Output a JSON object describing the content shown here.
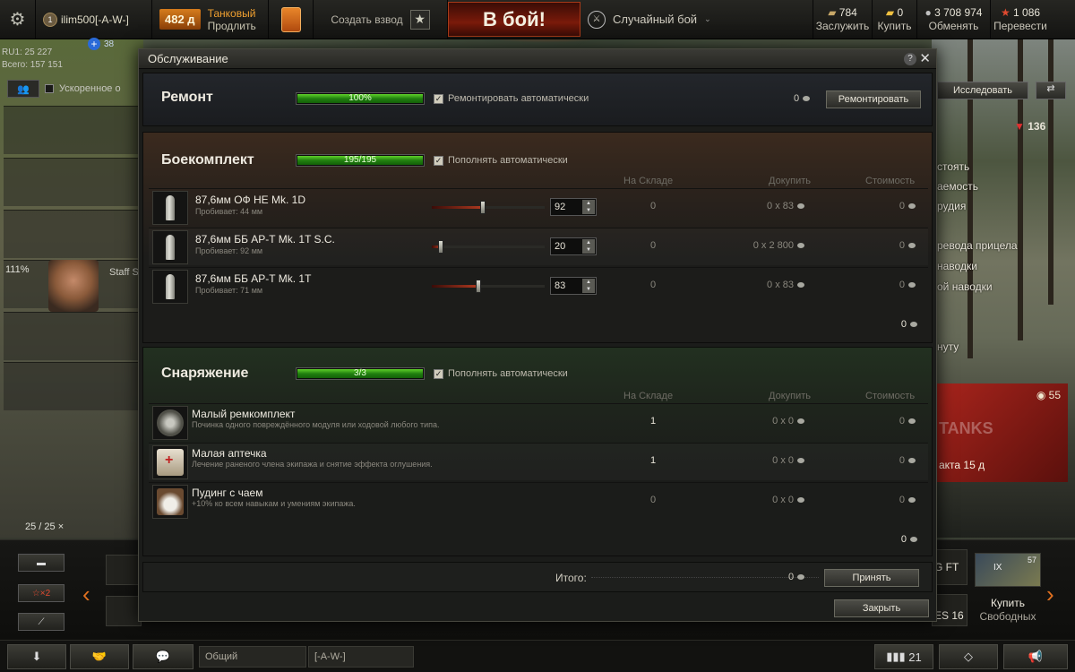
{
  "topbar": {
    "player_name": "ilim500[-A-W-]",
    "rank_badge": "1",
    "premium_days": "482 д",
    "premium_label": "Танковый",
    "premium_action": "Продлить",
    "platoon_label": "Создать взвод",
    "battle_button": "В бой!",
    "battle_mode": "Случайный бой",
    "resources": [
      {
        "value": "784",
        "label": "Заслужить",
        "icon": "xp-icon"
      },
      {
        "value": "0",
        "label": "Купить",
        "icon": "gold-icon"
      },
      {
        "value": "3 708 974",
        "label": "Обменять",
        "icon": "credits-icon"
      },
      {
        "value": "1 086",
        "label": "Перевести",
        "icon": "free-xp-icon"
      }
    ]
  },
  "left_info": {
    "line1": "RU1: 25 227",
    "line2": "Всего: 157 151",
    "notify_count": "38",
    "crew_label": "Ускоренное о",
    "crew_pct": "111%",
    "crew_role": "Staff S",
    "tank_count": "25 / 25"
  },
  "right_info": {
    "research": "Исследовать",
    "stat": "136",
    "lines": [
      "стоять",
      "аемость",
      "рудия",
      "ревода прицела",
      "наводки",
      "ой наводки",
      "нуту"
    ],
    "promo_count": "55",
    "promo_text": "акта 15 д",
    "promo_logo": "TANKS"
  },
  "dialog": {
    "title": "Обслуживание",
    "repair": {
      "title": "Ремонт",
      "progress_text": "100%",
      "progress": 1.0,
      "auto_label": "Ремонтировать автоматически",
      "auto_checked": true,
      "cost": "0",
      "button": "Ремонтировать"
    },
    "ammo": {
      "title": "Боекомплект",
      "progress_text": "195/195",
      "progress": 1.0,
      "auto_label": "Пополнять автоматически",
      "columns": [
        "На Складе",
        "Докупить",
        "Стоимость"
      ],
      "items": [
        {
          "name": "87,6мм ОФ HE Mk. 1D",
          "desc": "Пробивает: 44 мм",
          "count": "92",
          "level": 0.45,
          "stock": "0",
          "buy": "0 x 83",
          "cost": "0"
        },
        {
          "name": "87,6мм ББ AP-T Mk. 1T S.C.",
          "desc": "Пробивает: 92 мм",
          "count": "20",
          "level": 0.08,
          "stock": "0",
          "buy": "0 x 2 800",
          "cost": "0"
        },
        {
          "name": "87,6мм ББ AP-T Mk. 1T",
          "desc": "Пробивает: 71 мм",
          "count": "83",
          "level": 0.41,
          "stock": "0",
          "buy": "0 x 83",
          "cost": "0"
        }
      ],
      "subtotal": "0"
    },
    "equipment": {
      "title": "Снаряжение",
      "progress_text": "3/3",
      "progress": 1.0,
      "auto_label": "Пополнять автоматически",
      "columns": [
        "На Складе",
        "Докупить",
        "Стоимость"
      ],
      "items": [
        {
          "name": "Малый ремкомплект",
          "desc": "Починка одного повреждённого модуля или ходовой любого типа.",
          "stock": "1",
          "buy": "0 x 0",
          "cost": "0",
          "icon": "repair-kit-icon"
        },
        {
          "name": "Малая аптечка",
          "desc": "Лечение раненого члена экипажа и снятие эффекта оглушения.",
          "stock": "1",
          "buy": "0 x 0",
          "cost": "0",
          "icon": "first-aid-icon"
        },
        {
          "name": "Пудинг с чаем",
          "desc": "+10% ко всем навыкам и умениям экипажа.",
          "stock": "0",
          "buy": "0 x 0",
          "cost": "0",
          "icon": "pudding-tea-icon"
        }
      ],
      "subtotal": "0"
    },
    "total_label": "Итого:",
    "total_value": "0",
    "accept": "Принять",
    "close": "Закрыть"
  },
  "carousel": {
    "filter_x2": "×2",
    "buy_line1": "Купить",
    "buy_line2": "Свободных",
    "card_label_1": "G FT",
    "card_label_2": "ES 16",
    "card_tier": "IX",
    "card_count": "57"
  },
  "bottombar": {
    "channel_general": "Общий",
    "channel_clan": "[-A-W-]",
    "counter": "21"
  }
}
